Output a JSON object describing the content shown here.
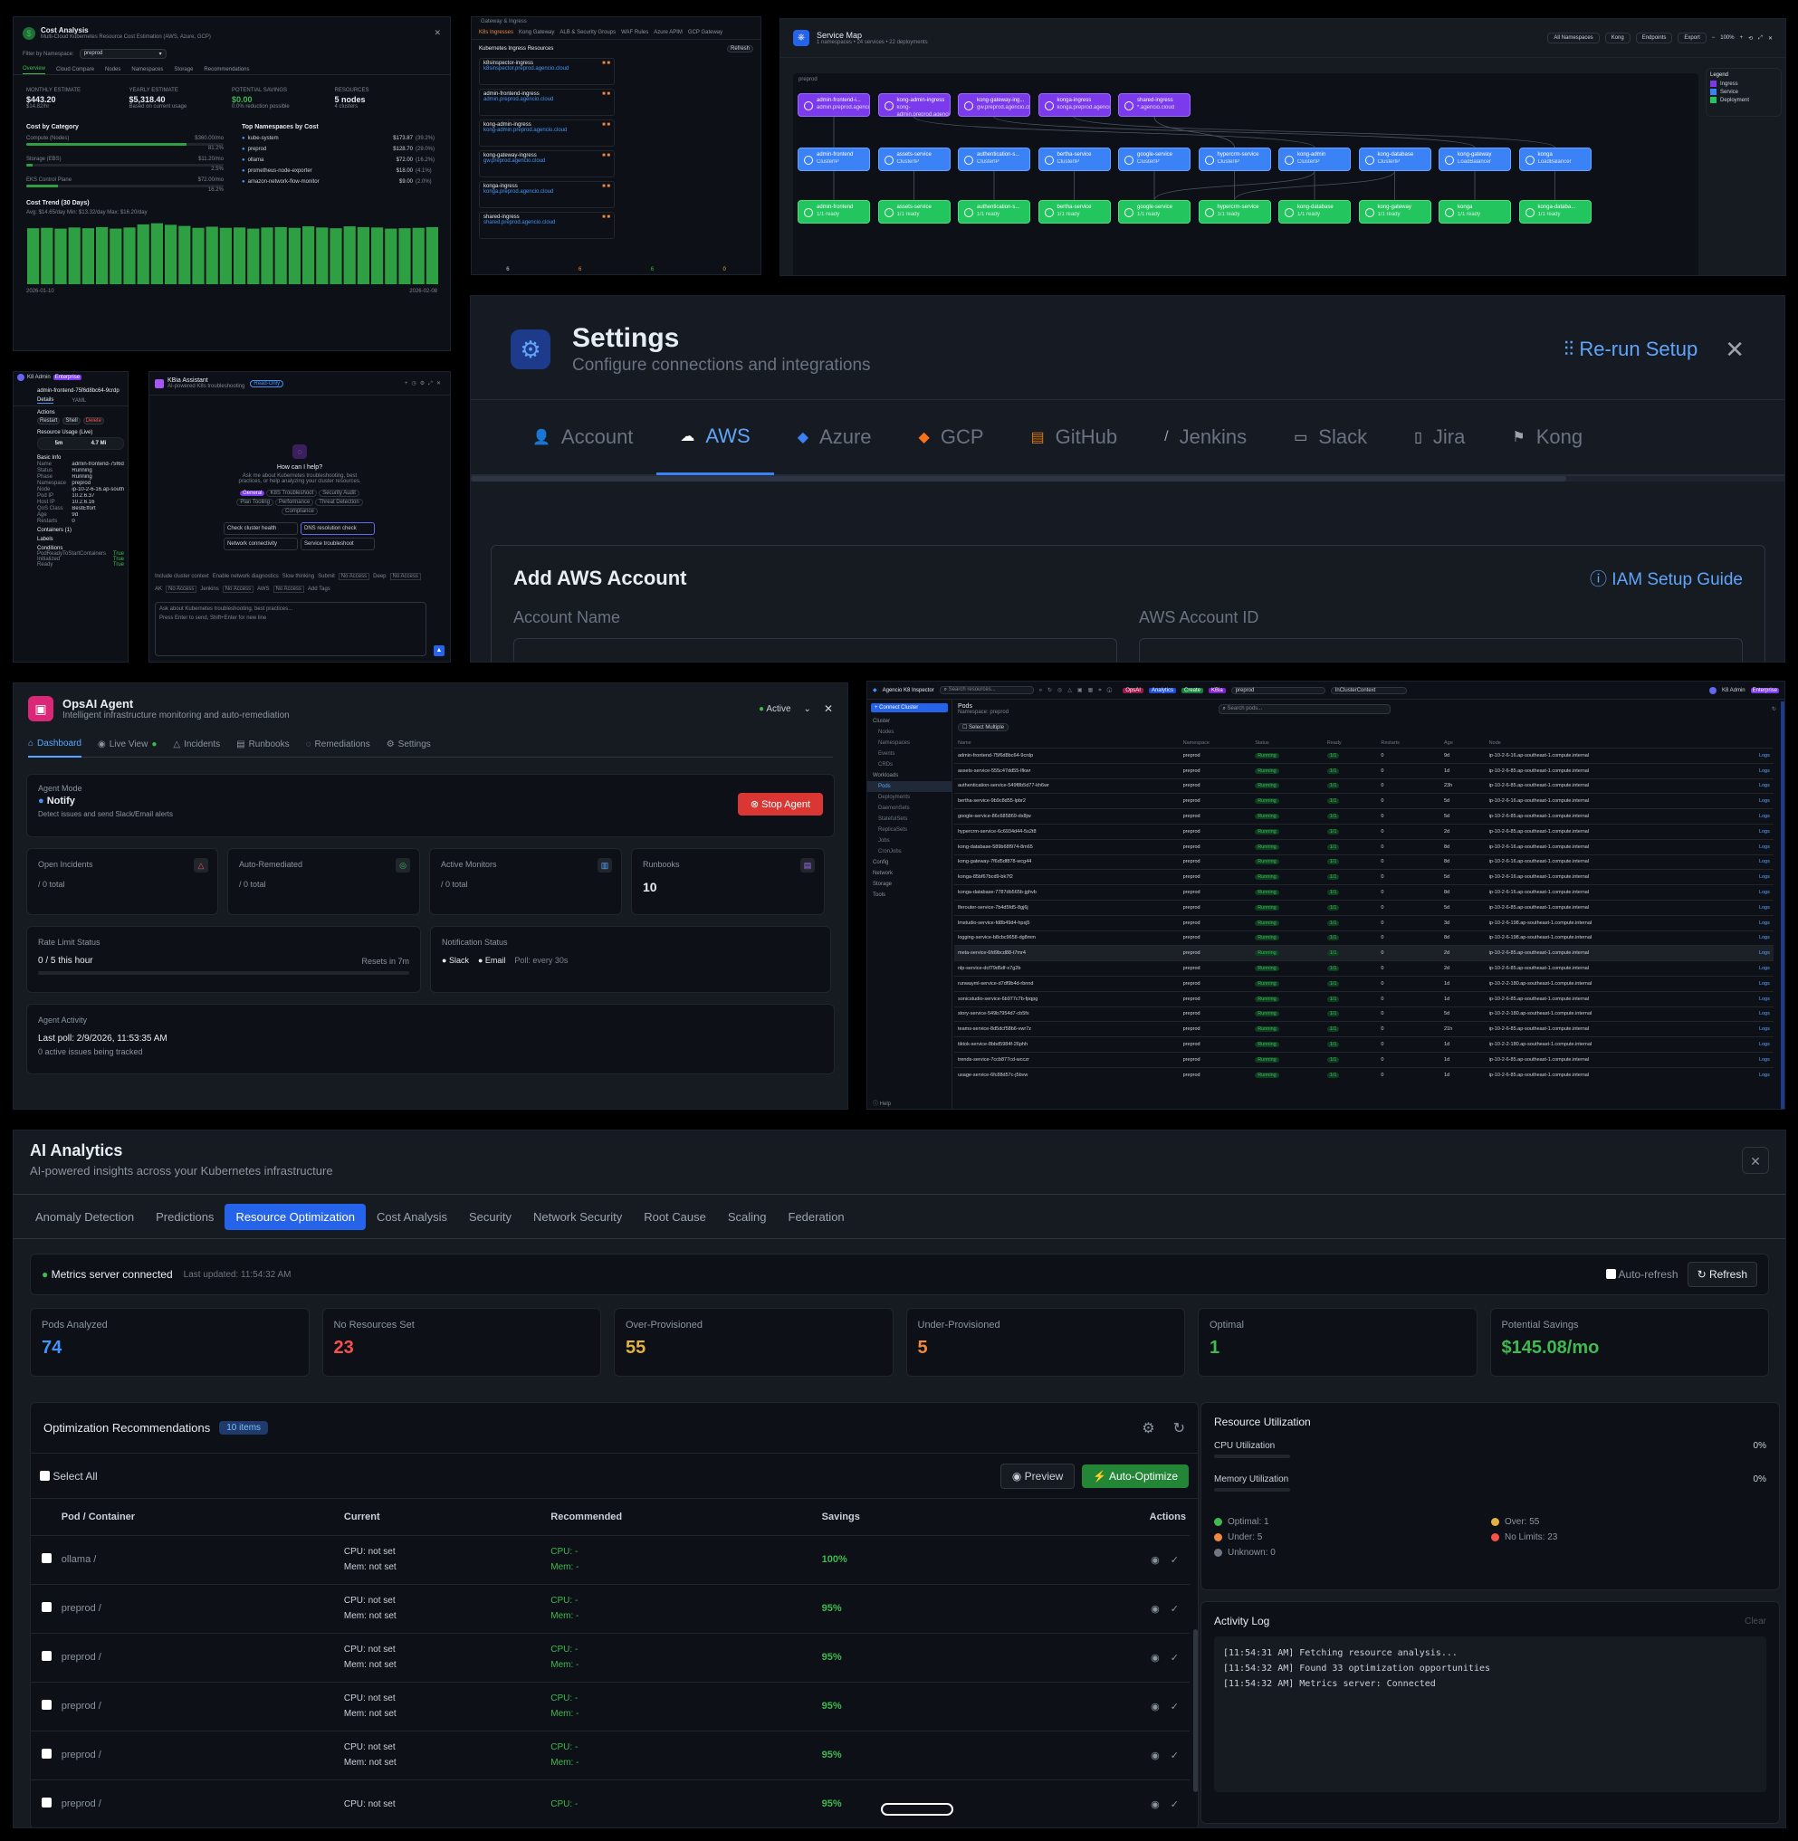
{
  "cost": {
    "title": "Cost Analysis",
    "subtitle": "Multi-Cloud Kubernetes Resource Cost Estimation (AWS, Azure, GCP)",
    "filter_label": "Filter by Namespace:",
    "filter_value": "preprod",
    "tabs": [
      "Overview",
      "Cloud Compare",
      "Nodes",
      "Namespaces",
      "Storage",
      "Recommendations"
    ],
    "kpis": [
      {
        "label": "MONTHLY ESTIMATE",
        "value": "$443.20",
        "sub": "$14.82/hr"
      },
      {
        "label": "YEARLY ESTIMATE",
        "value": "$5,318.40",
        "sub": "Based on current usage"
      },
      {
        "label": "POTENTIAL SAVINGS",
        "value": "$0.00",
        "sub": "0.0% reduction possible"
      },
      {
        "label": "RESOURCES",
        "value": "5 nodes",
        "sub": "4 clusters"
      }
    ],
    "cat_title": "Cost by Category",
    "categories": [
      {
        "name": "Compute (Nodes)",
        "value": "$360.00/mo",
        "pct": "81.2%",
        "fill": 0.81
      },
      {
        "name": "Storage (EBS)",
        "value": "$11.20/mo",
        "pct": "2.5%",
        "fill": 0.03
      },
      {
        "name": "EKS Control Plane",
        "value": "$72.00/mo",
        "pct": "16.2%",
        "fill": 0.16
      }
    ],
    "ns_title": "Top Namespaces by Cost",
    "namespaces": [
      {
        "name": "kube-system",
        "value": "$173.87",
        "pct": "(39.2%)"
      },
      {
        "name": "preprod",
        "value": "$128.70",
        "pct": "(29.0%)"
      },
      {
        "name": "ollama",
        "value": "$72.00",
        "pct": "(16.2%)"
      },
      {
        "name": "prometheus-node-exporter",
        "value": "$18.00",
        "pct": "(4.1%)"
      },
      {
        "name": "amazon-network-flow-monitor",
        "value": "$9.00",
        "pct": "(2.0%)"
      }
    ],
    "trend_title": "Cost Trend (30 Days)",
    "trend_stats": "Avg: $14.65/day    Min: $13.32/day    Max: $16.20/day",
    "trend_start": "2026-01-10",
    "trend_end": "2026-02-08",
    "trend_values": [
      14.6,
      14.7,
      14.5,
      14.8,
      14.6,
      14.9,
      14.5,
      14.8,
      15.6,
      15.9,
      15.5,
      15.2,
      14.7,
      15.0,
      14.7,
      14.8,
      14.5,
      14.8,
      14.9,
      14.7,
      15.1,
      14.8,
      14.6,
      15.1,
      14.9,
      14.8,
      14.5,
      14.6,
      14.7,
      14.9
    ]
  },
  "ingress": {
    "title": "Gateway & Ingress",
    "tabs": [
      "K8s Ingresses",
      "Kong Gateway",
      "ALB & Security Groups",
      "WAF Rules",
      "Azure APIM",
      "GCP Gateway"
    ],
    "section": "Kubernetes Ingress Resources",
    "refresh": "Refresh",
    "items": [
      {
        "name": "k8sinspector-ingress",
        "host": "k8sinspector.preprod.agencio.cloud"
      },
      {
        "name": "admin-frontend-ingress",
        "host": "admin.preprod.agencio.cloud"
      },
      {
        "name": "kong-admin-ingress",
        "host": "kong-admin.preprod.agencio.cloud"
      },
      {
        "name": "kong-gateway-ingress",
        "host": "gw.preprod.agencio.cloud"
      },
      {
        "name": "konga-ingress",
        "host": "konga.preprod.agencio.cloud"
      },
      {
        "name": "shared-ingress",
        "host": "shared.preprod.agencio.cloud"
      }
    ],
    "counts": [
      "6",
      "6",
      "6",
      "0"
    ]
  },
  "smap": {
    "title": "Service Map",
    "subtitle": "1 namespaces • 24 services • 22 deployments",
    "controls": [
      "All Namespaces",
      "Kong",
      "Endpoints",
      "Export",
      "100%"
    ],
    "ns": "preprod",
    "legend_title": "Legend",
    "legend": [
      "Ingress",
      "Service",
      "Deployment"
    ],
    "ingresses": [
      {
        "name": "admin-frontend-i...",
        "sub": "admin.preprod.agencio.cloud"
      },
      {
        "name": "kong-admin-ingress",
        "sub": "kong-admin.preprod.agencio.cloud"
      },
      {
        "name": "kong-gateway-ing...",
        "sub": "gw.preprod.agencio.cloud"
      },
      {
        "name": "konga-ingress",
        "sub": "konga.preprod.agencio.cloud"
      },
      {
        "name": "shared-ingress",
        "sub": "*.agencio.cloud"
      }
    ],
    "services": [
      {
        "name": "admin-frontend",
        "sub": "ClusterIP"
      },
      {
        "name": "assets-service",
        "sub": "ClusterIP"
      },
      {
        "name": "authentication-s...",
        "sub": "ClusterIP"
      },
      {
        "name": "bertha-service",
        "sub": "ClusterIP"
      },
      {
        "name": "google-service",
        "sub": "ClusterIP"
      },
      {
        "name": "hypercrm-service",
        "sub": "ClusterIP"
      },
      {
        "name": "kong-admin",
        "sub": "ClusterIP"
      },
      {
        "name": "kong-database",
        "sub": "ClusterIP"
      },
      {
        "name": "kong-gateway",
        "sub": "LoadBalancer"
      },
      {
        "name": "konga",
        "sub": "LoadBalancer"
      }
    ],
    "deployments": [
      {
        "name": "admin-frontend",
        "sub": "1/1 ready"
      },
      {
        "name": "assets-service",
        "sub": "1/1 ready"
      },
      {
        "name": "authentication-s...",
        "sub": "1/1 ready"
      },
      {
        "name": "bertha-service",
        "sub": "1/1 ready"
      },
      {
        "name": "google-service",
        "sub": "1/1 ready"
      },
      {
        "name": "hypercrm-service",
        "sub": "1/1 ready"
      },
      {
        "name": "kong-database",
        "sub": "1/1 ready"
      },
      {
        "name": "kong-gateway",
        "sub": "1/1 ready"
      },
      {
        "name": "konga",
        "sub": "1/1 ready"
      },
      {
        "name": "konga-databa...",
        "sub": "1/1 ready"
      }
    ]
  },
  "settings": {
    "title": "Settings",
    "subtitle": "Configure connections and integrations",
    "rerun": "Re-run Setup",
    "tabs": [
      "Account",
      "AWS",
      "Azure",
      "GCP",
      "GitHub",
      "Jenkins",
      "Slack",
      "Jira",
      "Kong"
    ],
    "section": "Add AWS Account",
    "guide": "IAM Setup Guide",
    "field1": "Account Name",
    "field2": "AWS Account ID"
  },
  "pod": {
    "name": "admin-frontend-75f6d8bc64-9crdp",
    "tabs": [
      "Details",
      "YAML"
    ],
    "user": "K8 Admin",
    "badge": "Enterprise",
    "actions": "Actions",
    "restart": "Restart",
    "shell": "Shell",
    "del": "Delete",
    "usage": "Resource Usage (Live)",
    "cpu": "5m",
    "mem": "4.7 Mi",
    "info": "Basic Info",
    "kv": [
      [
        "Name",
        "admin-frontend-75f6d8bc64-9crdp"
      ],
      [
        "Status",
        "Running"
      ],
      [
        "Phase",
        "Running"
      ],
      [
        "Namespace",
        "preprod"
      ],
      [
        "Node",
        "ip-10-2-6-16.ap-southeast-1.compute.internal"
      ],
      [
        "Pod IP",
        "10.2.6.37"
      ],
      [
        "Host IP",
        "10.2.6.16"
      ],
      [
        "QoS Class",
        "BestEffort"
      ],
      [
        "Age",
        "9d"
      ],
      [
        "Restarts",
        "0"
      ]
    ],
    "containers": "Containers (1)",
    "labels": "Labels",
    "conditions": "Conditions",
    "cond": [
      [
        "PodReadyToStartContainers",
        "True"
      ],
      [
        "Initialized",
        "True"
      ],
      [
        "Ready",
        "True"
      ]
    ]
  },
  "kiba": {
    "title": "KBia Assistant",
    "subtitle": "AI-powered K8s troubleshooting",
    "badge": "Read-Only",
    "help_title": "How can I help?",
    "help_text": "Ask me about Kubernetes troubleshooting, best practices, or help analyzing your cluster resources.",
    "chips": [
      "General",
      "K8S Troubleshoot",
      "Security Audit",
      "Plan Tooling",
      "Performance",
      "Threat Detection",
      "Compliance"
    ],
    "quick": [
      "Check cluster health",
      "DNS resolution check",
      "Network connectivity",
      "Service troubleshoot"
    ],
    "opts": [
      "Include cluster context",
      "Enable network diagnostics",
      "Slow thinking",
      "Submit",
      "No Access",
      "Deep",
      "No Access"
    ],
    "opts2": [
      "AK",
      "No Access",
      "Jenkins",
      "No Access",
      "AWS",
      "No Access",
      "Add Tags"
    ],
    "input": "Ask about Kubernetes troubleshooting, best practices...",
    "hint": "Press Enter to send, Shift+Enter for new line"
  },
  "opsai": {
    "title": "OpsAI Agent",
    "subtitle": "Intelligent infrastructure monitoring and auto-remediation",
    "status": "Active",
    "tabs": [
      "Dashboard",
      "Live View",
      "Incidents",
      "Runbooks",
      "Remediations",
      "Settings"
    ],
    "mode_label": "Agent Mode",
    "mode": "Notify",
    "mode_desc": "Detect issues and send Slack/Email alerts",
    "stop": "Stop Agent",
    "stats": [
      {
        "label": "Open Incidents",
        "value": "/ 0 total"
      },
      {
        "label": "Auto-Remediated",
        "value": "/ 0 total"
      },
      {
        "label": "Active Monitors",
        "value": "/ 0 total"
      },
      {
        "label": "Runbooks",
        "value": "10"
      }
    ],
    "rate_title": "Rate Limit Status",
    "rate": "0 / 5 this hour",
    "resets": "Resets in 7m",
    "notif_title": "Notification Status",
    "slack": "Slack",
    "email": "Email",
    "poll": "Poll: every 30s",
    "act_title": "Agent Activity",
    "last_poll": "Last poll: 2/9/2026, 11:53:35 AM",
    "issues": "0 active issues being tracked"
  },
  "insp": {
    "title": "Agencio K8 Inspector",
    "search": "Search resources...",
    "chips": [
      "OpsAI",
      "Analytics",
      "Create",
      "KBia"
    ],
    "ns": "preprod",
    "ctx": "InClusterContext",
    "user": "K8 Admin",
    "badge": "Enterprise",
    "connect": "Connect Cluster",
    "nav": [
      "Cluster",
      "Nodes",
      "Namespaces",
      "Events",
      "CRDs",
      "Workloads",
      "Pods",
      "Deployments",
      "DaemonSets",
      "StatefulSets",
      "ReplicaSets",
      "Jobs",
      "CronJobs",
      "Config",
      "Network",
      "Storage",
      "Tools"
    ],
    "help": "Help",
    "pods_title": "Pods",
    "pods_ns": "Namespace: preprod",
    "pods_search": "Search pods...",
    "select_multi": "Select Multiple",
    "cols": [
      "Name",
      "Namespace",
      "Status",
      "Ready",
      "Restarts",
      "Age",
      "Node",
      ""
    ],
    "rows": [
      [
        "admin-frontend-75f6d8bc64-9crdp",
        "preprod",
        "Running",
        "1/1",
        "0",
        "9d",
        "ip-10-2-6-16.ap-southeast-1.compute.internal",
        "Logs"
      ],
      [
        "assets-service-555c47dd55-lfkwr",
        "preprod",
        "Running",
        "1/1",
        "0",
        "1d",
        "ip-10-2-6-85.ap-southeast-1.compute.internal",
        "Logs"
      ],
      [
        "authentication-service-549f8b5d77-kh6wr",
        "preprod",
        "Running",
        "1/1",
        "0",
        "23h",
        "ip-10-2-6-85.ap-southeast-1.compute.internal",
        "Logs"
      ],
      [
        "bertha-service-9b9c8d55-lpbr2",
        "preprod",
        "Running",
        "1/1",
        "0",
        "5d",
        "ip-10-2-6-16.ap-southeast-1.compute.internal",
        "Logs"
      ],
      [
        "google-service-86c685869-dx8jw",
        "preprod",
        "Running",
        "1/1",
        "0",
        "5d",
        "ip-10-2-6-85.ap-southeast-1.compute.internal",
        "Logs"
      ],
      [
        "hypercrm-service-6c6934d44-5s2t8",
        "preprod",
        "Running",
        "1/1",
        "0",
        "2d",
        "ip-10-2-6-85.ap-southeast-1.compute.internal",
        "Logs"
      ],
      [
        "kong-database-589b68f974-8m65",
        "preprod",
        "Running",
        "1/1",
        "0",
        "8d",
        "ip-10-2-6-16.ap-southeast-1.compute.internal",
        "Logs"
      ],
      [
        "kong-gateway-7f6d5df878-wcg44",
        "preprod",
        "Running",
        "1/1",
        "0",
        "8d",
        "ip-10-2-6-16.ap-southeast-1.compute.internal",
        "Logs"
      ],
      [
        "konga-85bf67bcd9-bk7f2",
        "preprod",
        "Running",
        "1/1",
        "0",
        "5d",
        "ip-10-2-6-16.ap-southeast-1.compute.internal",
        "Logs"
      ],
      [
        "konga-database-7787db565b-jghvb",
        "preprod",
        "Running",
        "1/1",
        "0",
        "8d",
        "ip-10-2-6-16.ap-southeast-1.compute.internal",
        "Logs"
      ],
      [
        "lferouter-service-7b4d5fd5-8gj6j",
        "preprod",
        "Running",
        "1/1",
        "0",
        "5d",
        "ip-10-2-6-85.ap-southeast-1.compute.internal",
        "Logs"
      ],
      [
        "lmstudio-service-fd8b49d4-hpsj5",
        "preprod",
        "Running",
        "1/1",
        "0",
        "3d",
        "ip-10-2-6-198.ap-southeast-1.compute.internal",
        "Logs"
      ],
      [
        "logging-service-b8cbc9658-dg8mm",
        "preprod",
        "Running",
        "1/1",
        "0",
        "8d",
        "ip-10-2-6-198.ap-southeast-1.compute.internal",
        "Logs"
      ],
      [
        "meta-service-6fd9bcd88-t7mr4",
        "preprod",
        "Running",
        "1/1",
        "0",
        "2d",
        "ip-10-2-6-85.ap-southeast-1.compute.internal",
        "Logs"
      ],
      [
        "nlp-service-dcf79d5df-x7g2b",
        "preprod",
        "Running",
        "1/1",
        "0",
        "2d",
        "ip-10-2-6-85.ap-southeast-1.compute.internal",
        "Logs"
      ],
      [
        "runwayml-service-d7df9b4d-rbnnd",
        "preprod",
        "Running",
        "1/1",
        "0",
        "1d",
        "ip-10-2-2-180.ap-southeast-1.compute.internal",
        "Logs"
      ],
      [
        "sonicstudio-service-6b977c7b-fpqpg",
        "preprod",
        "Running",
        "1/1",
        "0",
        "1d",
        "ip-10-2-6-85.ap-southeast-1.compute.internal",
        "Logs"
      ],
      [
        "story-service-549b7954d7-cb5fx",
        "preprod",
        "Running",
        "1/1",
        "0",
        "5d",
        "ip-10-2-2-180.ap-southeast-1.compute.internal",
        "Logs"
      ],
      [
        "teams-service-8d5dcf58b6-vwr7z",
        "preprod",
        "Running",
        "1/1",
        "0",
        "21h",
        "ip-10-2-6-85.ap-southeast-1.compute.internal",
        "Logs"
      ],
      [
        "tiktok-service-8bbd5984f-26phh",
        "preprod",
        "Running",
        "1/1",
        "0",
        "1d",
        "ip-10-2-2-180.ap-southeast-1.compute.internal",
        "Logs"
      ],
      [
        "trends-service-7ccb877cd-wcczr",
        "preprod",
        "Running",
        "1/1",
        "0",
        "1d",
        "ip-10-2-6-85.ap-southeast-1.compute.internal",
        "Logs"
      ],
      [
        "usage-service-6fc88d57c-j5bvw",
        "preprod",
        "Running",
        "1/1",
        "0",
        "1d",
        "ip-10-2-6-85.ap-southeast-1.compute.internal",
        "Logs"
      ]
    ]
  },
  "ai": {
    "title": "AI Analytics",
    "subtitle": "AI-powered insights across your Kubernetes infrastructure",
    "tabs": [
      "Anomaly Detection",
      "Predictions",
      "Resource Optimization",
      "Cost Analysis",
      "Security",
      "Network Security",
      "Root Cause",
      "Scaling",
      "Federation"
    ],
    "active_tab": 2,
    "metrics": "Metrics server connected",
    "updated": "Last updated: 11:54:32 AM",
    "autorefresh": "Auto-refresh",
    "refresh": "Refresh",
    "kpis": [
      {
        "label": "Pods Analyzed",
        "value": "74",
        "color": "#4493f8"
      },
      {
        "label": "No Resources Set",
        "value": "23",
        "color": "#f85149"
      },
      {
        "label": "Over-Provisioned",
        "value": "55",
        "color": "#e3b341"
      },
      {
        "label": "Under-Provisioned",
        "value": "5",
        "color": "#f0883e"
      },
      {
        "label": "Optimal",
        "value": "1",
        "color": "#3fb950"
      },
      {
        "label": "Potential Savings",
        "value": "$145.08/mo",
        "color": "#3fb950"
      }
    ],
    "rec_title": "Optimization Recommendations",
    "rec_count": "10 items",
    "select_all": "Select All",
    "preview": "Preview",
    "auto": "Auto-Optimize",
    "cols": [
      "Pod / Container",
      "Current",
      "Recommended",
      "Savings",
      "Actions"
    ],
    "rows": [
      {
        "pod": "ollama /",
        "cur1": "CPU: not set",
        "cur2": "Mem: not set",
        "rec1": "CPU: -",
        "rec2": "Mem: -",
        "save": "100%"
      },
      {
        "pod": "preprod /",
        "cur1": "CPU: not set",
        "cur2": "Mem: not set",
        "rec1": "CPU: -",
        "rec2": "Mem: -",
        "save": "95%"
      },
      {
        "pod": "preprod /",
        "cur1": "CPU: not set",
        "cur2": "Mem: not set",
        "rec1": "CPU: -",
        "rec2": "Mem: -",
        "save": "95%"
      },
      {
        "pod": "preprod /",
        "cur1": "CPU: not set",
        "cur2": "Mem: not set",
        "rec1": "CPU: -",
        "rec2": "Mem: -",
        "save": "95%"
      },
      {
        "pod": "preprod /",
        "cur1": "CPU: not set",
        "cur2": "Mem: not set",
        "rec1": "CPU: -",
        "rec2": "Mem: -",
        "save": "95%"
      },
      {
        "pod": "preprod /",
        "cur1": "CPU: not set",
        "cur2": "",
        "rec1": "CPU: -",
        "rec2": "",
        "save": "95%"
      }
    ],
    "util_title": "Resource Utilization",
    "cpu_label": "CPU Utilization",
    "cpu_val": "0%",
    "mem_label": "Memory Utilization",
    "mem_val": "0%",
    "legend": [
      {
        "label": "Optimal: 1",
        "color": "#3fb950"
      },
      {
        "label": "Over: 55",
        "color": "#e3b341"
      },
      {
        "label": "Under: 5",
        "color": "#f0883e"
      },
      {
        "label": "No Limits: 23",
        "color": "#f85149"
      },
      {
        "label": "Unknown: 0",
        "color": "#6e7681"
      }
    ],
    "log_title": "Activity Log",
    "clear": "Clear",
    "log": [
      "[11:54:31 AM] Fetching resource analysis...",
      "[11:54:32 AM] Found 33 optimization opportunities",
      "[11:54:32 AM] Metrics server: Connected"
    ]
  }
}
